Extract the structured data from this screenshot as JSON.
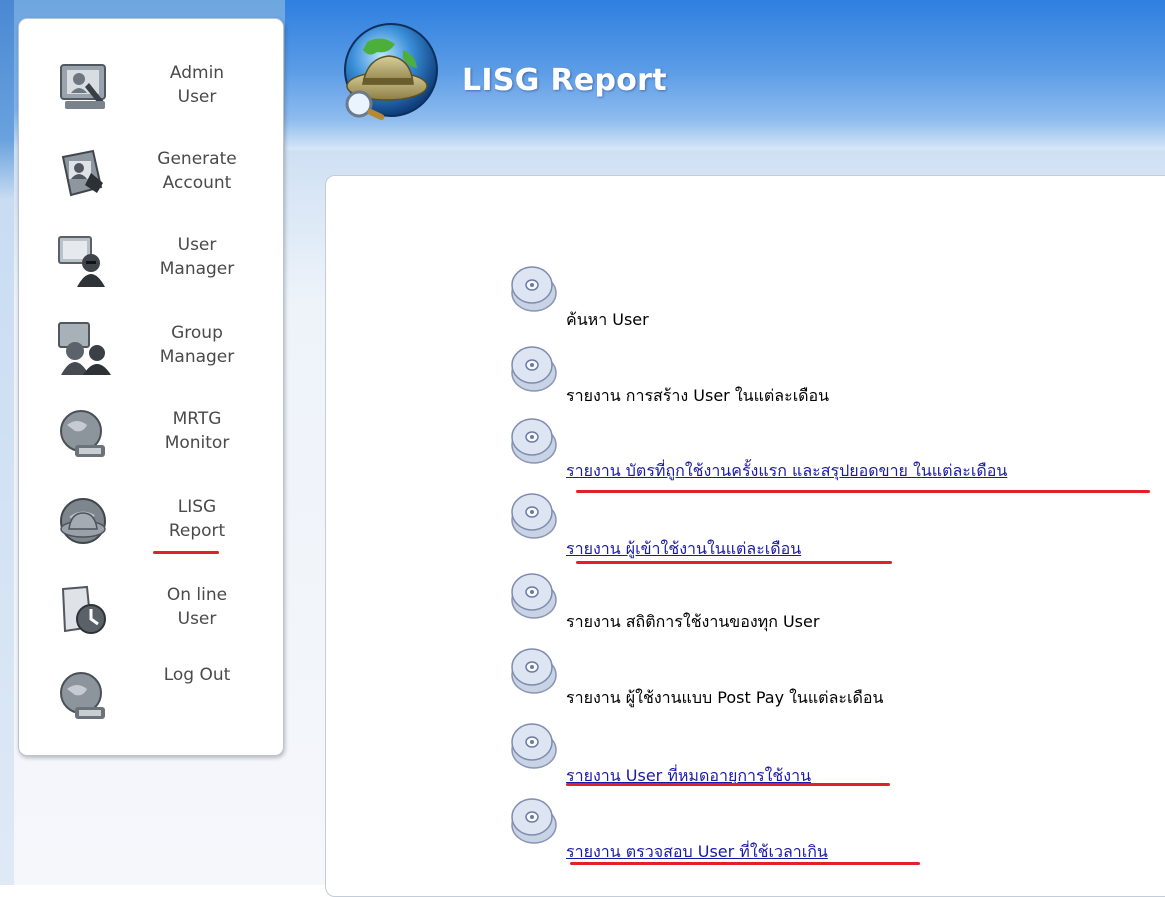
{
  "app": {
    "title": "LISG Report"
  },
  "sidebar": {
    "items": [
      {
        "line1": "Admin",
        "line2": "User",
        "icon": "admin-user-icon"
      },
      {
        "line1": "Generate",
        "line2": "Account",
        "icon": "generate-account-icon"
      },
      {
        "line1": "User",
        "line2": "Manager",
        "icon": "user-manager-icon"
      },
      {
        "line1": "Group",
        "line2": "Manager",
        "icon": "group-manager-icon"
      },
      {
        "line1": "MRTG",
        "line2": "Monitor",
        "icon": "mrtg-monitor-icon"
      },
      {
        "line1": "LISG",
        "line2": "Report",
        "icon": "lisg-report-icon",
        "active": true
      },
      {
        "line1": "On line",
        "line2": "User",
        "icon": "online-user-icon"
      },
      {
        "line1": "Log Out",
        "line2": "",
        "icon": "logout-icon"
      }
    ]
  },
  "reports": {
    "items": [
      {
        "label": "ค้นหา User",
        "underlined": false,
        "highlighted": false
      },
      {
        "label": "รายงาน การสร้าง User ในแต่ละเดือน",
        "underlined": false,
        "highlighted": false
      },
      {
        "label": "รายงาน บัตรที่ถูกใช้งานครั้งแรก และสรุปยอดขาย ในแต่ละเดือน",
        "underlined": true,
        "highlighted": true
      },
      {
        "label": "รายงาน ผู้เข้าใช้งานในแต่ละเดือน",
        "underlined": true,
        "highlighted": true
      },
      {
        "label": "รายงาน สถิติการใช้งานของทุก User",
        "underlined": false,
        "highlighted": false
      },
      {
        "label": "รายงาน ผู้ใช้งานแบบ Post Pay ในแต่ละเดือน",
        "underlined": false,
        "highlighted": false
      },
      {
        "label": "รายงาน User ที่หมดอายุการใช้งาน",
        "underlined": true,
        "highlighted": true
      },
      {
        "label": "รายงาน ตรวจสอบ User ที่ใช้เวลาเกิน",
        "underlined": true,
        "highlighted": true
      }
    ]
  },
  "colors": {
    "accent_red": "#e0202a",
    "header_blue": "#2e7fe0",
    "link_blue": "#1a1aa8"
  }
}
